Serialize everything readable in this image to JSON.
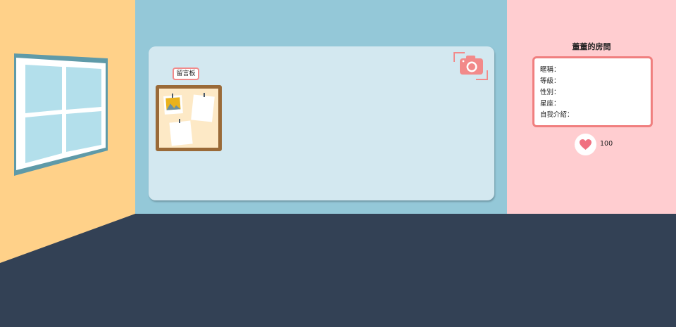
{
  "colors": {
    "left_wall": "#ffd189",
    "back_wall": "#94c8d8",
    "right_wall": "#ffcdd0",
    "floor": "#334155",
    "accent": "#f28a8a"
  },
  "board": {
    "tag_label": "留言板"
  },
  "room": {
    "title": "董董的房間"
  },
  "profile": {
    "fields": [
      {
        "label": "暱稱："
      },
      {
        "label": "等級："
      },
      {
        "label": "性別："
      },
      {
        "label": "星座："
      },
      {
        "label": "自我介紹："
      }
    ]
  },
  "likes": {
    "count": "100"
  },
  "icons": {
    "camera": "camera-icon",
    "heart": "heart-icon",
    "photo": "photo-icon",
    "window": "window-icon"
  }
}
